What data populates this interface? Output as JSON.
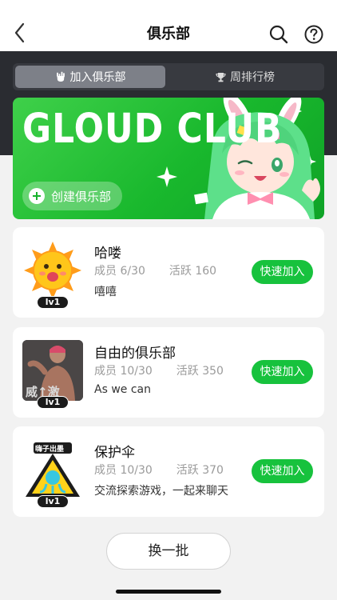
{
  "header": {
    "title": "俱乐部",
    "back_icon": "chevron-left-icon",
    "search_icon": "search-icon",
    "help_icon": "help-icon"
  },
  "tabs": [
    {
      "label": "加入俱乐部",
      "icon": "hand-rock-icon",
      "active": true
    },
    {
      "label": "周排行榜",
      "icon": "trophy-icon",
      "active": false
    }
  ],
  "banner": {
    "title": "GLOUD CLUB",
    "create_label": "创建俱乐部",
    "accent": "#18b22c"
  },
  "clubs": [
    {
      "name": "哈喽",
      "members": "成员 6/30",
      "activity": "活跃 160",
      "description": "嘻嘻",
      "level": "lv1",
      "join_label": "快速加入"
    },
    {
      "name": "自由的俱乐部",
      "members": "成员 10/30",
      "activity": "活跃 350",
      "description": "As we can",
      "level": "lv1",
      "join_label": "快速加入",
      "avatar_text": "威↑激"
    },
    {
      "name": "保护伞",
      "members": "成员 10/30",
      "activity": "活跃 370",
      "description": "交流探索游戏，一起来聊天",
      "level": "lv1",
      "join_label": "快速加入",
      "avatar_text": "嗨子出墨"
    }
  ],
  "refresh_label": "换一批",
  "colors": {
    "join_green": "#17c23d",
    "dark_band": "#2a2c31"
  }
}
